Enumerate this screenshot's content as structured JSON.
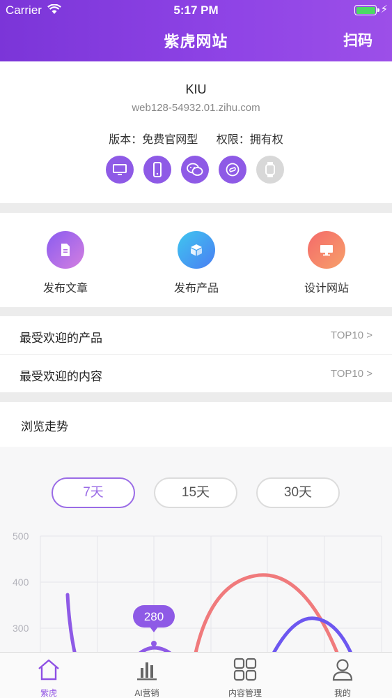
{
  "status_bar": {
    "carrier": "Carrier",
    "time": "5:17 PM"
  },
  "header": {
    "title": "紫虎网站",
    "scan_label": "扫码"
  },
  "site": {
    "name": "KIU",
    "url": "web128-54932.01.zihu.com",
    "version": "版本：免费官网型",
    "permission": "权限：拥有权",
    "platform_icons": [
      "desktop-icon",
      "mobile-icon",
      "wechat-icon",
      "mini-program-icon",
      "watch-icon"
    ]
  },
  "actions": [
    {
      "label": "发布文章",
      "icon": "document-icon",
      "color": "#b36be3"
    },
    {
      "label": "发布产品",
      "icon": "box-icon",
      "color": "#4aa8ef"
    },
    {
      "label": "设计网站",
      "icon": "monitor-icon",
      "color": "#f5776b"
    }
  ],
  "lists": [
    {
      "label": "最受欢迎的产品",
      "link": "TOP10 >"
    },
    {
      "label": "最受欢迎的内容",
      "link": "TOP10 >"
    }
  ],
  "trend": {
    "title": "浏览走势",
    "ranges": [
      "7天",
      "15天",
      "30天"
    ],
    "active_range": "7天",
    "tooltip": "280"
  },
  "chart_data": {
    "type": "line",
    "yticks": [
      "500",
      "400",
      "300"
    ],
    "ylim": [
      300,
      500
    ],
    "tooltip_value": 280,
    "colors": {
      "purple": "#8e5ae6",
      "red": "#f07a7c",
      "violet": "#6d57f0"
    }
  },
  "tabs": [
    {
      "label": "紫虎",
      "icon": "home-icon",
      "active": true
    },
    {
      "label": "AI营销",
      "icon": "bar-chart-icon",
      "active": false
    },
    {
      "label": "内容管理",
      "icon": "grid-icon",
      "active": false
    },
    {
      "label": "我的",
      "icon": "user-icon",
      "active": false
    }
  ]
}
